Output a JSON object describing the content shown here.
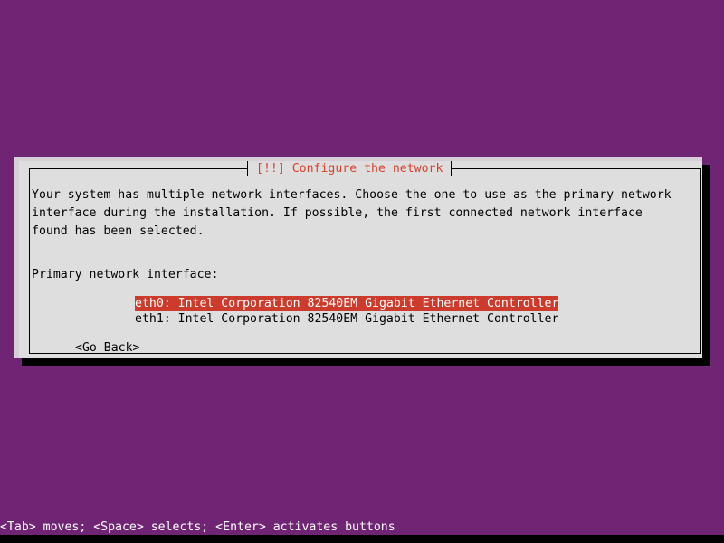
{
  "screen": {
    "background_color": "#6f2573",
    "bottom_strip_color": "#000000"
  },
  "dialog": {
    "title": "[!!] Configure the network",
    "title_color": "#d8402c",
    "background_color": "#dedede",
    "shadow_color": "#000000",
    "paragraph": [
      "Your system has multiple network interfaces. Choose the one to use as the primary network",
      "interface during the installation. If possible, the first connected network interface",
      "found has been selected."
    ],
    "prompt_label": "Primary network interface:",
    "choices": [
      {
        "label": "eth0: Intel Corporation 82540EM Gigabit Ethernet Controller",
        "selected": true
      },
      {
        "label": "eth1: Intel Corporation 82540EM Gigabit Ethernet Controller",
        "selected": false
      }
    ],
    "selection_highlight_color": "#cc3b2c",
    "selection_text_color": "#ffffff",
    "go_back_button": "<Go Back>"
  },
  "status_bar": {
    "text": "<Tab> moves; <Space> selects; <Enter> activates buttons",
    "text_color": "#ffffff"
  }
}
